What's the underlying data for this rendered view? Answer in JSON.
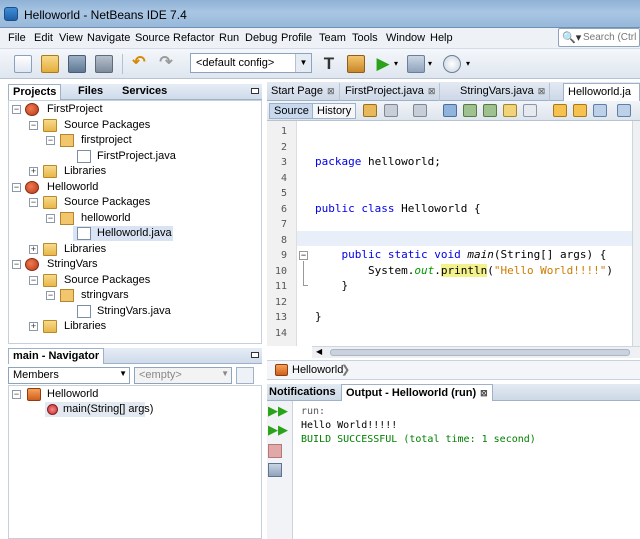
{
  "window": {
    "title": "Helloworld - NetBeans IDE 7.4"
  },
  "menu": [
    "File",
    "Edit",
    "View",
    "Navigate",
    "Source",
    "Refactor",
    "Run",
    "Debug",
    "Profile",
    "Team",
    "Tools",
    "Window",
    "Help"
  ],
  "search": {
    "placeholder": "Search (Ctrl"
  },
  "toolbar": {
    "config_value": "<default config>"
  },
  "projects_panel": {
    "tabs": [
      "Projects",
      "Files",
      "Services"
    ],
    "tree": [
      {
        "label": "FirstProject",
        "type": "project"
      },
      {
        "label": "Source Packages",
        "type": "folder"
      },
      {
        "label": "firstproject",
        "type": "package"
      },
      {
        "label": "FirstProject.java",
        "type": "java"
      },
      {
        "label": "Libraries",
        "type": "folder"
      },
      {
        "label": "Helloworld",
        "type": "project"
      },
      {
        "label": "Source Packages",
        "type": "folder"
      },
      {
        "label": "helloworld",
        "type": "package"
      },
      {
        "label": "Helloworld.java",
        "type": "java"
      },
      {
        "label": "Libraries",
        "type": "folder"
      },
      {
        "label": "StringVars",
        "type": "project"
      },
      {
        "label": "Source Packages",
        "type": "folder"
      },
      {
        "label": "stringvars",
        "type": "package"
      },
      {
        "label": "StringVars.java",
        "type": "java"
      },
      {
        "label": "Libraries",
        "type": "folder"
      }
    ]
  },
  "navigator": {
    "title": "main - Navigator",
    "members_label": "Members",
    "filter_value": "<empty>",
    "tree": [
      "Helloworld",
      "main(String[] args)"
    ]
  },
  "editor": {
    "tabs": [
      "Start Page",
      "FirstProject.java",
      "StringVars.java",
      "Helloworld.ja"
    ],
    "source_label": "Source",
    "history_label": "History",
    "line_numbers": [
      "1",
      "2",
      "3",
      "4",
      "5",
      "6",
      "7",
      "8",
      "9",
      "10",
      "11",
      "12",
      "13",
      "14"
    ],
    "code": {
      "l3_kw": "package",
      "l3_rest": " helloworld;",
      "l6_kw": "public class",
      "l6_rest": " Helloworld {",
      "l9_kw": "    public static void",
      "l9_method": "main",
      "l9_rest": "(String[] args) {",
      "l10_a": "        System.",
      "l10_field": "out",
      "l10_dot": ".",
      "l10_call": "println",
      "l10_open": "(",
      "l10_str": "\"Hello World!!!!\"",
      "l10_close": ")",
      "l11": "    }",
      "l13": "}"
    },
    "breadcrumb": "Helloworld"
  },
  "output": {
    "tabs": [
      "Notifications",
      "Output - Helloworld (run)"
    ],
    "lines": [
      "run:",
      "Hello World!!!!!",
      "BUILD SUCCESSFUL (total time: 1 second)"
    ],
    "colors": {
      "run": "#5b5b5b",
      "hello": "#000000",
      "build": "#008000"
    }
  }
}
